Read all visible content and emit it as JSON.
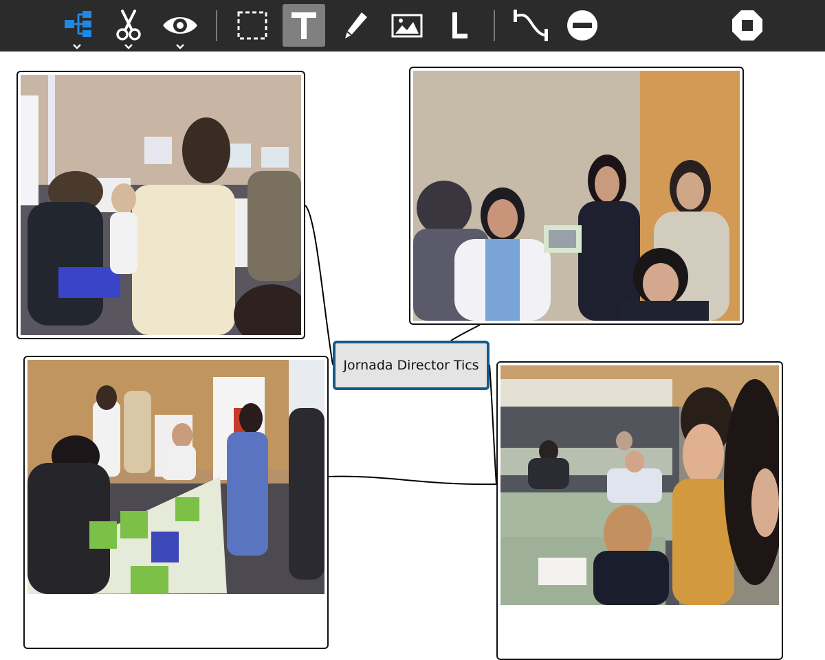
{
  "toolbar": {
    "tools": [
      {
        "name": "tree",
        "icon": "mind-map-tree-icon",
        "has_dropdown": true
      },
      {
        "name": "cut",
        "icon": "scissors-icon",
        "has_dropdown": true
      },
      {
        "name": "view",
        "icon": "eye-icon",
        "has_dropdown": true
      },
      {
        "name": "selection",
        "icon": "dashed-selection-icon"
      },
      {
        "name": "text",
        "icon": "text-t-icon",
        "active": true
      },
      {
        "name": "pencil",
        "icon": "pencil-icon"
      },
      {
        "name": "image",
        "icon": "image-icon"
      },
      {
        "name": "label",
        "icon": "letter-l-icon"
      },
      {
        "name": "connect",
        "icon": "connector-curve-icon"
      },
      {
        "name": "delete",
        "icon": "remove-circle-icon"
      },
      {
        "name": "stop",
        "icon": "stop-octagon-icon"
      }
    ],
    "colors": {
      "background": "#2b2b2b",
      "active": "#808080",
      "accent": "#1e88e5"
    }
  },
  "mindmap": {
    "central_node": {
      "text": "Jornada Director Tics",
      "border_color": "#145a8a",
      "fill": "#e4e4e4"
    },
    "photo_nodes": [
      {
        "id": "photo-top-left",
        "description_icon": "workshop-photo"
      },
      {
        "id": "photo-top-right",
        "description_icon": "students-photo"
      },
      {
        "id": "photo-bottom-left",
        "description_icon": "laptops-table-photo"
      },
      {
        "id": "photo-bottom-right",
        "description_icon": "auditorium-photo"
      }
    ]
  }
}
